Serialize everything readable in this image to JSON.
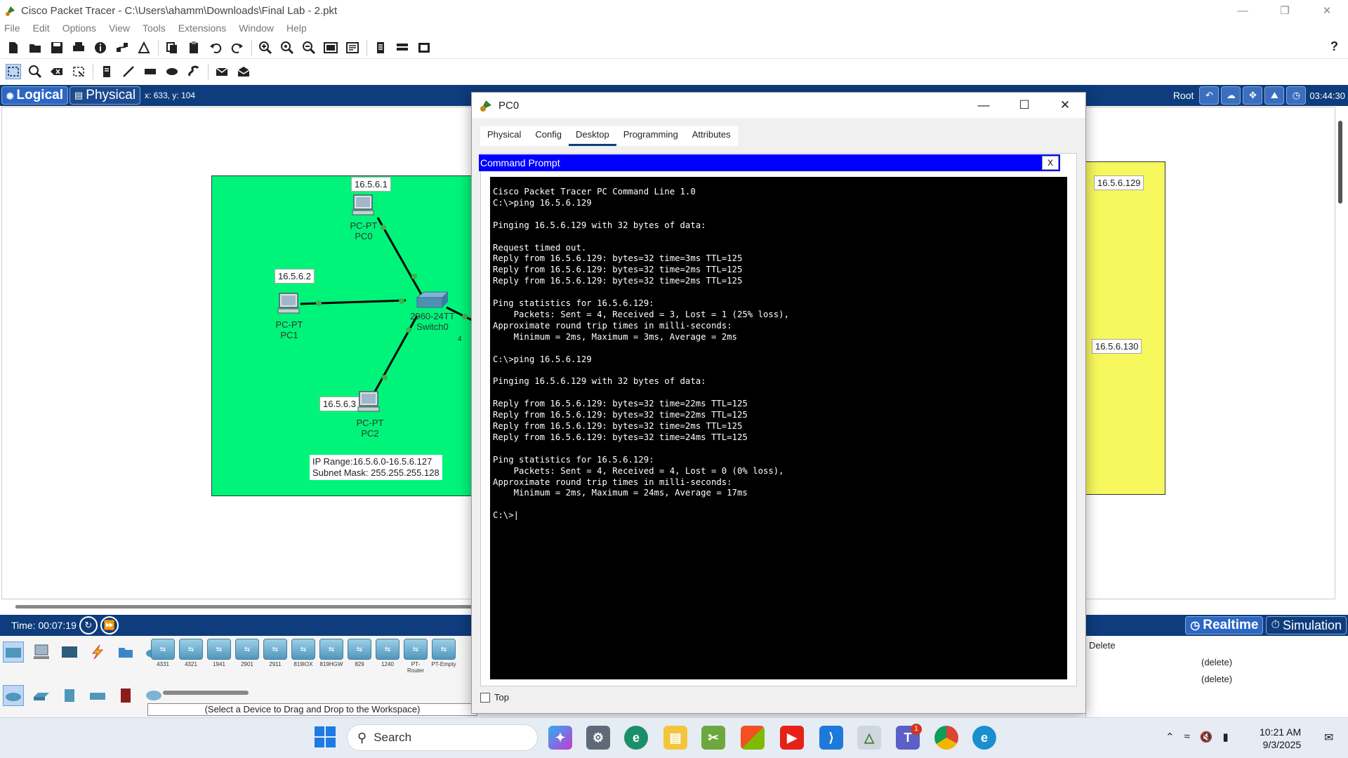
{
  "window": {
    "title": "Cisco Packet Tracer - C:\\Users\\ahamm\\Downloads\\Final Lab - 2.pkt"
  },
  "menu": [
    "File",
    "Edit",
    "Options",
    "View",
    "Tools",
    "Extensions",
    "Window",
    "Help"
  ],
  "toolbar1_icons": [
    "new-file-icon",
    "open-folder-icon",
    "save-icon",
    "print-icon",
    "info-icon",
    "network-wizard-icon",
    "activity-wizard-icon",
    "copy-icon",
    "paste-icon",
    "undo-icon",
    "redo-icon",
    "zoom-in-icon",
    "zoom-reset-icon",
    "zoom-out-icon",
    "drawing-palette-icon",
    "custom-device-icon",
    "notes-icon",
    "viewport-icon",
    "cluster-icon"
  ],
  "toolbar2_icons": [
    "select-icon",
    "inspect-icon",
    "delete-icon",
    "resize-icon",
    "note-icon",
    "line-icon",
    "rectangle-icon",
    "ellipse-icon",
    "freeform-icon",
    "simple-pdu-icon",
    "complex-pdu-icon"
  ],
  "help_label": "?",
  "viewbar": {
    "logical": "Logical",
    "physical": "Physical",
    "coords": "x: 633, y: 104",
    "root": "Root",
    "clock": "03:44:30"
  },
  "workspace": {
    "ip_pc0": "16.5.6.1",
    "pc0_type": "PC-PT",
    "pc0_name": "PC0",
    "ip_pc1": "16.5.6.2",
    "pc1_type": "PC-PT",
    "pc1_name": "PC1",
    "ip_pc2": "16.5.6.3",
    "pc2_type": "PC-PT",
    "pc2_name": "PC2",
    "switch_type": "2960-24TT",
    "switch_name": "Switch0",
    "info_line1": "IP Range:16.5.6.0-16.5.6.127",
    "info_line2": "Subnet Mask: 255.255.255.128",
    "ip_right1": "16.5.6.129",
    "ip_right2": "16.5.6.130",
    "stray_mark": "4"
  },
  "timebar": {
    "time": "Time: 00:07:19",
    "realtime": "Realtime",
    "simulation": "Simulation"
  },
  "palette": {
    "devices": [
      "4331",
      "4321",
      "1941",
      "2901",
      "2911",
      "819IOX",
      "819HGW",
      "829",
      "1240",
      "PT-Router",
      "PT-Empty"
    ],
    "hint": "(Select a Device to Drag and Drop to the Workspace)"
  },
  "pdu_panel": {
    "header": "Delete",
    "rows": [
      "(delete)",
      "(delete)"
    ]
  },
  "pc_window": {
    "title": "PC0",
    "tabs": [
      "Physical",
      "Config",
      "Desktop",
      "Programming",
      "Attributes"
    ],
    "active_tab": "Desktop",
    "cmd_title": "Command Prompt",
    "cmd_close": "X",
    "terminal_text": "Cisco Packet Tracer PC Command Line 1.0\nC:\\>ping 16.5.6.129\n\nPinging 16.5.6.129 with 32 bytes of data:\n\nRequest timed out.\nReply from 16.5.6.129: bytes=32 time=3ms TTL=125\nReply from 16.5.6.129: bytes=32 time=2ms TTL=125\nReply from 16.5.6.129: bytes=32 time=2ms TTL=125\n\nPing statistics for 16.5.6.129:\n    Packets: Sent = 4, Received = 3, Lost = 1 (25% loss),\nApproximate round trip times in milli-seconds:\n    Minimum = 2ms, Maximum = 3ms, Average = 2ms\n\nC:\\>ping 16.5.6.129\n\nPinging 16.5.6.129 with 32 bytes of data:\n\nReply from 16.5.6.129: bytes=32 time=22ms TTL=125\nReply from 16.5.6.129: bytes=32 time=22ms TTL=125\nReply from 16.5.6.129: bytes=32 time=2ms TTL=125\nReply from 16.5.6.129: bytes=32 time=24ms TTL=125\n\nPing statistics for 16.5.6.129:\n    Packets: Sent = 4, Received = 4, Lost = 0 (0% loss),\nApproximate round trip times in milli-seconds:\n    Minimum = 2ms, Maximum = 24ms, Average = 17ms\n\nC:\\>|",
    "top_checkbox": "Top"
  },
  "taskbar": {
    "search": "Search",
    "apps": [
      "copilot-icon",
      "settings-icon",
      "edge-icon",
      "file-explorer-icon",
      "snipping-tool-icon",
      "microsoft-store-icon",
      "youtube-icon",
      "vscode-icon",
      "packet-tracer-icon",
      "teams-icon",
      "chrome-icon",
      "edge-beta-icon"
    ],
    "teams_badge": "1",
    "time": "10:21 AM",
    "date": "9/3/2025"
  }
}
